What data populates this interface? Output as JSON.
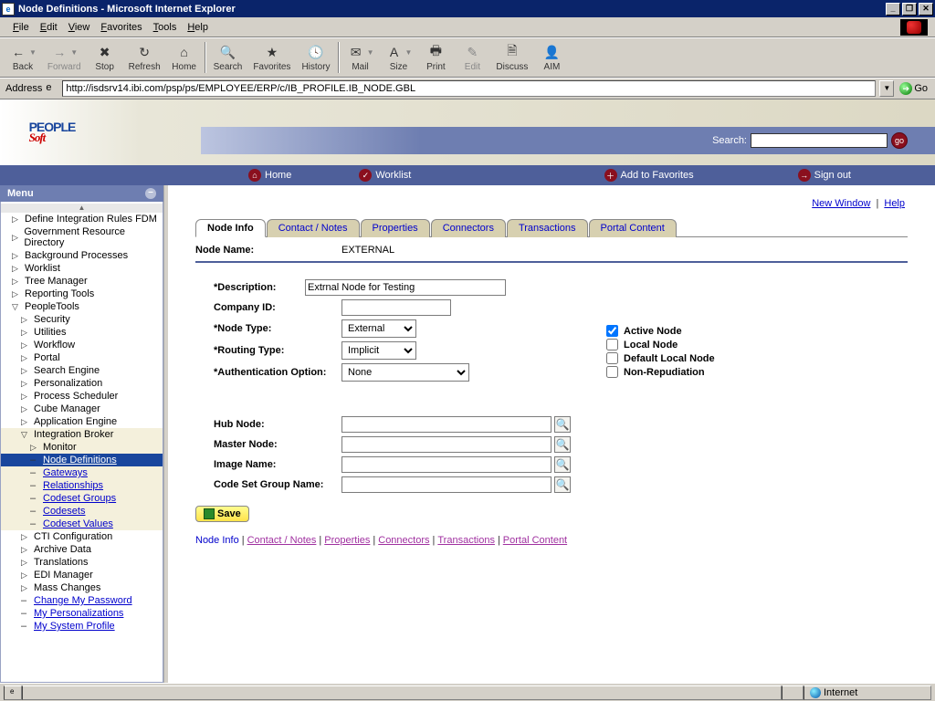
{
  "window": {
    "title": "Node Definitions - Microsoft Internet Explorer"
  },
  "menubar": [
    "File",
    "Edit",
    "View",
    "Favorites",
    "Tools",
    "Help"
  ],
  "toolbar": [
    {
      "label": "Back",
      "icon": "←",
      "drop": true
    },
    {
      "label": "Forward",
      "icon": "→",
      "drop": true,
      "disabled": true
    },
    {
      "label": "Stop",
      "icon": "✖"
    },
    {
      "label": "Refresh",
      "icon": "↻"
    },
    {
      "label": "Home",
      "icon": "⌂"
    },
    {
      "sep": true
    },
    {
      "label": "Search",
      "icon": "🔍"
    },
    {
      "label": "Favorites",
      "icon": "★"
    },
    {
      "label": "History",
      "icon": "🕓"
    },
    {
      "sep": true
    },
    {
      "label": "Mail",
      "icon": "✉",
      "drop": true
    },
    {
      "label": "Size",
      "icon": "A",
      "drop": true
    },
    {
      "label": "Print",
      "icon": "🖶"
    },
    {
      "label": "Edit",
      "icon": "✎",
      "disabled": true
    },
    {
      "label": "Discuss",
      "icon": "🗎"
    },
    {
      "label": "AIM",
      "icon": "👤"
    }
  ],
  "address": {
    "label": "Address",
    "url": "http://isdsrv14.ibi.com/psp/ps/EMPLOYEE/ERP/c/IB_PROFILE.IB_NODE.GBL",
    "go": "Go"
  },
  "header": {
    "logo_top": "PEOPLE",
    "logo_bot": "Soft",
    "search_label": "Search:",
    "search_value": "",
    "go": "go",
    "nav": [
      {
        "icon": "⌂",
        "label": "Home"
      },
      {
        "icon": "✓",
        "label": "Worklist"
      },
      {
        "icon": "＋",
        "label": "Add to Favorites"
      },
      {
        "icon": "→",
        "label": "Sign out"
      }
    ]
  },
  "sidebar": {
    "title": "Menu",
    "items": [
      {
        "type": "closed",
        "label": "Define Integration Rules FDM"
      },
      {
        "type": "closed",
        "label": "Government Resource Directory"
      },
      {
        "type": "closed",
        "label": "Background Processes"
      },
      {
        "type": "closed",
        "label": "Worklist"
      },
      {
        "type": "closed",
        "label": "Tree Manager"
      },
      {
        "type": "closed",
        "label": "Reporting Tools"
      },
      {
        "type": "open",
        "label": "PeopleTools",
        "children": [
          {
            "type": "closed",
            "label": "Security"
          },
          {
            "type": "closed",
            "label": "Utilities"
          },
          {
            "type": "closed",
            "label": "Workflow"
          },
          {
            "type": "closed",
            "label": "Portal"
          },
          {
            "type": "closed",
            "label": "Search Engine"
          },
          {
            "type": "closed",
            "label": "Personalization"
          },
          {
            "type": "closed",
            "label": "Process Scheduler"
          },
          {
            "type": "closed",
            "label": "Cube Manager"
          },
          {
            "type": "closed",
            "label": "Application Engine"
          },
          {
            "type": "open",
            "label": "Integration Broker",
            "hl": true,
            "children": [
              {
                "type": "closed",
                "label": "Monitor",
                "hl": true
              },
              {
                "type": "link",
                "label": "Node Definitions",
                "selected": true
              },
              {
                "type": "link",
                "label": "Gateways",
                "hl": true
              },
              {
                "type": "link",
                "label": "Relationships",
                "hl": true
              },
              {
                "type": "link",
                "label": "Codeset Groups",
                "hl": true
              },
              {
                "type": "link",
                "label": "Codesets",
                "hl": true
              },
              {
                "type": "link",
                "label": "Codeset Values",
                "hl": true
              }
            ]
          },
          {
            "type": "closed",
            "label": "CTI Configuration"
          },
          {
            "type": "closed",
            "label": "Archive Data"
          },
          {
            "type": "closed",
            "label": "Translations"
          },
          {
            "type": "closed",
            "label": "EDI Manager"
          },
          {
            "type": "closed",
            "label": "Mass Changes"
          },
          {
            "type": "link",
            "label": "Change My Password"
          },
          {
            "type": "link",
            "label": "My Personalizations"
          },
          {
            "type": "link",
            "label": "My System Profile"
          }
        ]
      }
    ]
  },
  "rpane": {
    "top_links": {
      "new_window": "New Window",
      "help": "Help"
    },
    "tabs": [
      "Node Info",
      "Contact / Notes",
      "Properties",
      "Connectors",
      "Transactions",
      "Portal Content"
    ],
    "active_tab": 0,
    "node_name_label": "Node Name:",
    "node_name_value": "EXTERNAL",
    "fields": {
      "description": {
        "label": "*Description:",
        "value": "Extrnal Node for Testing"
      },
      "company": {
        "label": "Company ID:",
        "value": ""
      },
      "node_type": {
        "label": "*Node Type:",
        "value": "External"
      },
      "routing_type": {
        "label": "*Routing Type:",
        "value": "Implicit"
      },
      "auth": {
        "label": "*Authentication Option:",
        "value": "None"
      }
    },
    "checks": [
      {
        "label": "Active Node",
        "checked": true
      },
      {
        "label": "Local Node",
        "checked": false
      },
      {
        "label": "Default Local Node",
        "checked": false
      },
      {
        "label": "Non-Repudiation",
        "checked": false
      }
    ],
    "lookups": [
      {
        "label": "Hub Node:",
        "value": ""
      },
      {
        "label": "Master Node:",
        "value": ""
      },
      {
        "label": "Image Name:",
        "value": ""
      },
      {
        "label": "Code Set Group Name:",
        "value": ""
      }
    ],
    "save": "Save",
    "bottom_links": [
      "Node Info",
      "Contact / Notes",
      "Properties",
      "Connectors",
      "Transactions",
      "Portal Content"
    ]
  },
  "statusbar": {
    "zone": "Internet"
  }
}
